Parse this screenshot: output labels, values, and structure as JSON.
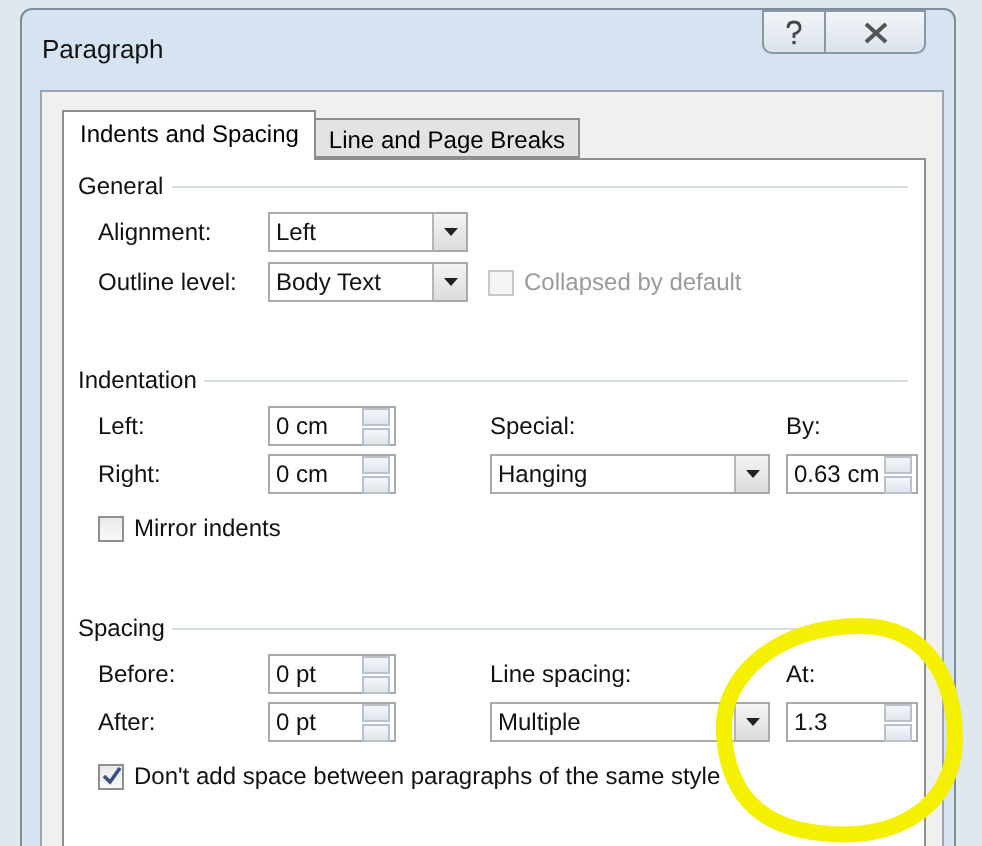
{
  "window": {
    "title": "Paragraph"
  },
  "tabs": [
    {
      "label": "Indents and Spacing",
      "selected": true
    },
    {
      "label": "Line and Page Breaks",
      "selected": false
    }
  ],
  "general": {
    "title": "General",
    "alignment": {
      "label": "Alignment:",
      "value": "Left"
    },
    "outline_level": {
      "label": "Outline level:",
      "value": "Body Text"
    },
    "collapsed": {
      "label": "Collapsed by default",
      "checked": false,
      "disabled": true
    }
  },
  "indentation": {
    "title": "Indentation",
    "left": {
      "label": "Left:",
      "value": "0 cm"
    },
    "right": {
      "label": "Right:",
      "value": "0 cm"
    },
    "special": {
      "label": "Special:",
      "value": "Hanging"
    },
    "by": {
      "label": "By:",
      "value": "0.63 cm"
    },
    "mirror": {
      "label": "Mirror indents",
      "checked": false,
      "disabled": false
    }
  },
  "spacing": {
    "title": "Spacing",
    "before": {
      "label": "Before:",
      "value": "0 pt"
    },
    "after": {
      "label": "After:",
      "value": "0 pt"
    },
    "line_spacing": {
      "label": "Line spacing:",
      "value": "Multiple"
    },
    "at": {
      "label": "At:",
      "value": "1.3"
    },
    "dont_add": {
      "label": "Don't add space between paragraphs of the same style",
      "checked": true,
      "disabled": false
    }
  }
}
